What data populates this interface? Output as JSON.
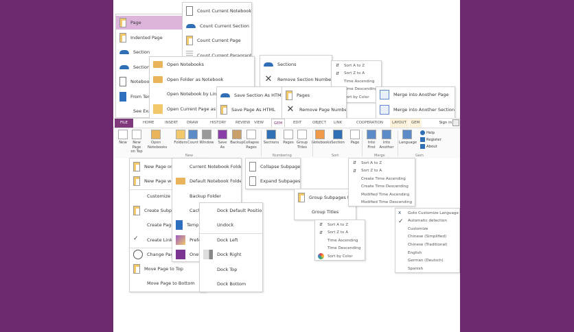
{
  "insert_menu": {
    "items": [
      {
        "label": "Page",
        "icon": "page-icon"
      },
      {
        "label": "Indented Page",
        "icon": "page-icon"
      },
      {
        "label": "Section",
        "icon": "section-icon"
      },
      {
        "label": "Section G",
        "icon": "section-group-icon"
      },
      {
        "label": "Notebook",
        "icon": "notebook-icon"
      },
      {
        "label": "From Tem",
        "icon": "template-icon"
      },
      {
        "label": "See Exam",
        "icon": ""
      }
    ]
  },
  "count_menu": {
    "items": [
      {
        "label": "Count Current Notebook",
        "icon": "notebook-icon"
      },
      {
        "label": "Count Current Section",
        "icon": "section-icon"
      },
      {
        "label": "Count Current Page",
        "icon": "page-icon"
      },
      {
        "label": "Count Current Paragraph",
        "icon": "paragraph-icon"
      }
    ]
  },
  "open_menu": {
    "items": [
      {
        "label": "Open Notebooks",
        "icon": "folder-icon"
      },
      {
        "label": "Open Folder as Notebook",
        "icon": "folder-icon"
      },
      {
        "label": "Open Notebook by Link",
        "icon": ""
      },
      {
        "label": "Open Current Page as SideN",
        "icon": "sticky-note-icon"
      }
    ]
  },
  "save_menu": {
    "items": [
      {
        "label": "Save Section As HTML",
        "icon": "section-icon"
      },
      {
        "label": "Save Page As HTML",
        "icon": "page-icon"
      }
    ]
  },
  "section_numbers_menu": {
    "items": [
      {
        "label": "Sections",
        "icon": "section-icon"
      },
      {
        "label": "Remove Section Numbers",
        "icon": "remove-icon"
      }
    ]
  },
  "sort_sections_menu": {
    "items": [
      {
        "label": "Sort A to Z",
        "icon": "sort-icon"
      },
      {
        "label": "Sort Z to A",
        "icon": "sort-icon"
      },
      {
        "label": "Time Ascending",
        "icon": ""
      },
      {
        "label": "Time Descending",
        "icon": ""
      },
      {
        "label": "Sort by Color",
        "icon": "color-icon"
      }
    ]
  },
  "page_numbers_menu": {
    "items": [
      {
        "label": "Pages",
        "icon": "page-icon"
      },
      {
        "label": "Remove Page Numbers",
        "icon": "remove-icon"
      }
    ]
  },
  "merge_menu": {
    "items": [
      {
        "label": "Merge into Another Page",
        "icon": "merge-icon"
      },
      {
        "label": "Merge into Another Section...",
        "icon": "merge-icon"
      }
    ]
  },
  "ribbon": {
    "tabs": [
      "FILE",
      "HOME",
      "INSERT",
      "DRAW",
      "HISTORY",
      "REVIEW",
      "VIEW",
      "GEM",
      "EDIT",
      "OBJECT",
      "LINK",
      "COOPERATION",
      "LAYOUT",
      "GEM"
    ],
    "sign_in": "Sign in",
    "buttons": [
      [
        "New"
      ],
      [
        "New Page",
        "on Top"
      ],
      [
        "Open",
        "Notebooks"
      ],
      [
        "Folders"
      ],
      [
        "Count"
      ],
      [
        "Window"
      ],
      [
        "Save",
        "As"
      ],
      [
        "Backup"
      ],
      [
        "Collapse",
        "Pages"
      ],
      [
        "Sections"
      ],
      [
        "Pages"
      ],
      [
        "Group",
        "Titles"
      ],
      [
        "Notebooks"
      ],
      [
        "Section"
      ],
      [
        "Page"
      ],
      [
        "Into",
        "First"
      ],
      [
        "Into",
        "Another"
      ],
      [
        "Language"
      ]
    ],
    "small_buttons": [
      "Help",
      "Register",
      "About"
    ],
    "groups": [
      "New",
      "Numbering",
      "Sort",
      "Merge",
      "Gem"
    ]
  },
  "new_page_menu": {
    "items": [
      {
        "label": "New Page on T",
        "icon": "page-icon"
      },
      {
        "label": "New Page wit",
        "icon": "page-icon"
      },
      {
        "label": "Customize Ne",
        "icon": ""
      },
      {
        "label": "Create Subpag",
        "icon": "page-icon"
      },
      {
        "label": "Create Pages U",
        "icon": ""
      },
      {
        "label": "Create Links wi",
        "icon": "check-icon"
      },
      {
        "label": "Change Page T",
        "icon": "clock-icon"
      },
      {
        "label": "Move Page to Top",
        "icon": "page-icon"
      },
      {
        "label": "Move Page to Bottom",
        "icon": ""
      }
    ]
  },
  "folders_menu": {
    "items": [
      {
        "label": "Current Notebook Folder",
        "icon": ""
      },
      {
        "label": "Default Notebook Folder",
        "icon": "folder-icon"
      },
      {
        "label": "Backup Folder",
        "icon": ""
      },
      {
        "label": "Cache F",
        "icon": ""
      },
      {
        "label": "Templ",
        "icon": "template-icon"
      },
      {
        "label": "Prefer",
        "icon": "preferences-icon"
      },
      {
        "label": "OneNo",
        "icon": "onenote-icon"
      }
    ]
  },
  "dock_menu": {
    "items": [
      {
        "label": "Dock Default Position",
        "icon": ""
      },
      {
        "label": "Undock",
        "icon": ""
      },
      {
        "label": "Dock Left",
        "icon": ""
      },
      {
        "label": "Dock Right",
        "icon": "dock-icon"
      },
      {
        "label": "Dock Top",
        "icon": ""
      },
      {
        "label": "Dock Bottom",
        "icon": ""
      }
    ]
  },
  "subpages_menu": {
    "items": [
      {
        "label": "Collapse Subpages",
        "icon": "subpage-icon"
      },
      {
        "label": "Expand Subpages",
        "icon": "subpage-icon"
      }
    ]
  },
  "group_titles_menu": {
    "items": [
      {
        "label": "Group Subpages title",
        "icon": "page-icon"
      },
      {
        "label": "Group Titles",
        "icon": ""
      }
    ]
  },
  "sort_pages_menu": {
    "items": [
      {
        "label": "Sort A to Z",
        "icon": "sort-icon"
      },
      {
        "label": "Sort Z to A",
        "icon": "sort-icon"
      },
      {
        "label": "Create Time Ascending",
        "icon": ""
      },
      {
        "label": "Create Time Descending",
        "icon": ""
      },
      {
        "label": "Modified Time Ascending",
        "icon": ""
      },
      {
        "label": "Modified Time Descending",
        "icon": ""
      }
    ]
  },
  "sort_notebooks_menu": {
    "items": [
      {
        "label": "Sort A to Z",
        "icon": "sort-icon"
      },
      {
        "label": "Sort Z to A",
        "icon": "sort-icon"
      },
      {
        "label": "Time Ascending",
        "icon": ""
      },
      {
        "label": "Time Descending",
        "icon": ""
      },
      {
        "label": "Sort by Color",
        "icon": "color-icon"
      }
    ]
  },
  "language_menu": {
    "items": [
      {
        "label": "Goto Customize Language",
        "icon": "language-icon"
      },
      {
        "label": "Automatic detection",
        "icon": "check-icon"
      },
      {
        "label": "Customize",
        "icon": ""
      },
      {
        "label": "Chinese (Simplified)",
        "icon": ""
      },
      {
        "label": "Chinese (Traditional)",
        "icon": ""
      },
      {
        "label": "English",
        "icon": ""
      },
      {
        "label": "German (Deutsch)",
        "icon": ""
      },
      {
        "label": "Spanish",
        "icon": ""
      }
    ]
  }
}
